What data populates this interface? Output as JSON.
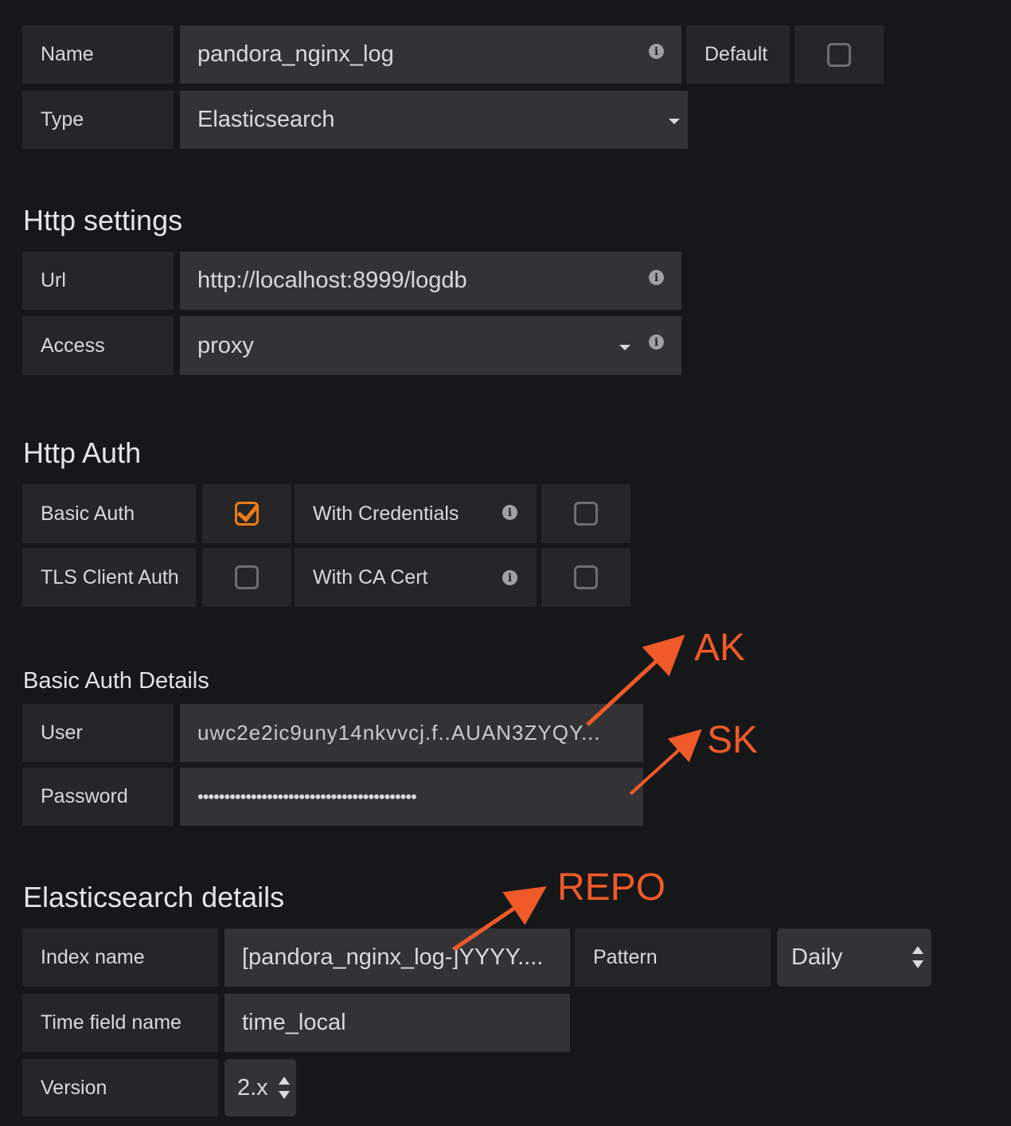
{
  "general": {
    "name_label": "Name",
    "name_value": "pandora_nginx_log",
    "default_label": "Default",
    "default_checked": false,
    "type_label": "Type",
    "type_value": "Elasticsearch"
  },
  "http_settings": {
    "title": "Http settings",
    "url_label": "Url",
    "url_value": "http://localhost:8999/logdb",
    "access_label": "Access",
    "access_value": "proxy"
  },
  "http_auth": {
    "title": "Http Auth",
    "basic_auth_label": "Basic Auth",
    "basic_auth_checked": true,
    "with_credentials_label": "With Credentials",
    "with_credentials_checked": false,
    "tls_client_auth_label": "TLS Client Auth",
    "tls_client_auth_checked": false,
    "with_ca_cert_label": "With CA Cert",
    "with_ca_cert_checked": false
  },
  "basic_auth_details": {
    "title": "Basic Auth Details",
    "user_label": "User",
    "user_value": "uwc2e2ic9uny14nkvvcj.f..AUAN3ZYQY...",
    "password_label": "Password",
    "password_value": "•••••••••••••••••••••••••••••••••••••••••"
  },
  "elasticsearch_details": {
    "title": "Elasticsearch details",
    "index_name_label": "Index name",
    "index_name_value": "[pandora_nginx_log-]YYYY....",
    "pattern_label": "Pattern",
    "pattern_value": "Daily",
    "time_field_label": "Time field name",
    "time_field_value": "time_local",
    "version_label": "Version",
    "version_value": "2.x"
  },
  "annotations": {
    "ak": "AK",
    "sk": "SK",
    "repo": "REPO",
    "color": "#f05a28"
  },
  "colors": {
    "background": "#161719",
    "label_bg": "#262628",
    "input_bg": "#333336",
    "checkbox_accent": "#eb7b18"
  }
}
